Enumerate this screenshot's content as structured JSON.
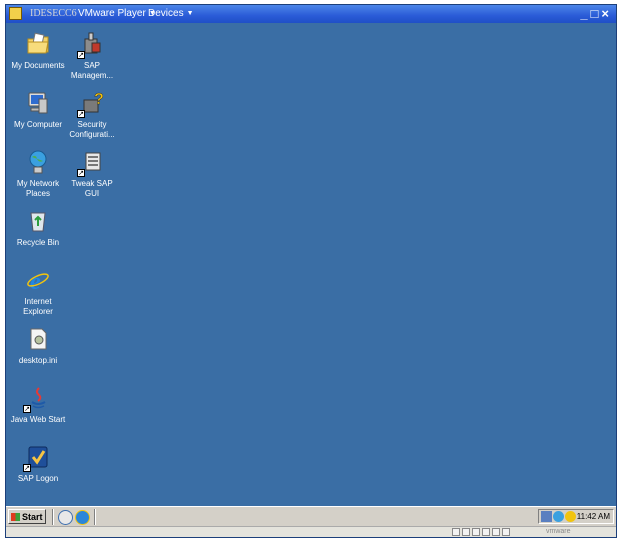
{
  "titlebar": {
    "host_name": "IDESECC6",
    "app_name": "VMware Player",
    "menu_label": "Devices",
    "minimize_glyph": "_",
    "maximize_glyph": "□",
    "close_glyph": "×"
  },
  "desktop_icons": [
    {
      "label": "My Documents",
      "icon": "folder-documents-icon"
    },
    {
      "label": "SAP Managem...",
      "icon": "sap-management-icon"
    },
    {
      "label": "My Computer",
      "icon": "computer-icon"
    },
    {
      "label": "Security Configurati...",
      "icon": "security-config-icon"
    },
    {
      "label": "My Network Places",
      "icon": "network-places-icon"
    },
    {
      "label": "Tweak SAP GUI",
      "icon": "tweak-sap-icon"
    },
    {
      "label": "Recycle Bin",
      "icon": "recycle-bin-icon"
    },
    {
      "label": "Internet Explorer",
      "icon": "internet-explorer-icon"
    },
    {
      "label": "desktop.ini",
      "icon": "ini-file-icon"
    },
    {
      "label": "Java Web Start",
      "icon": "java-icon"
    },
    {
      "label": "SAP Logon",
      "icon": "sap-logon-icon"
    }
  ],
  "taskbar": {
    "start_label": "Start",
    "clock": "11:42 AM"
  },
  "statusbar": {
    "logo_text": "vmware"
  },
  "colors": {
    "desktop": "#3a6ea5",
    "titlebar": "#2a5bd7",
    "taskbar": "#d4d0c8"
  }
}
